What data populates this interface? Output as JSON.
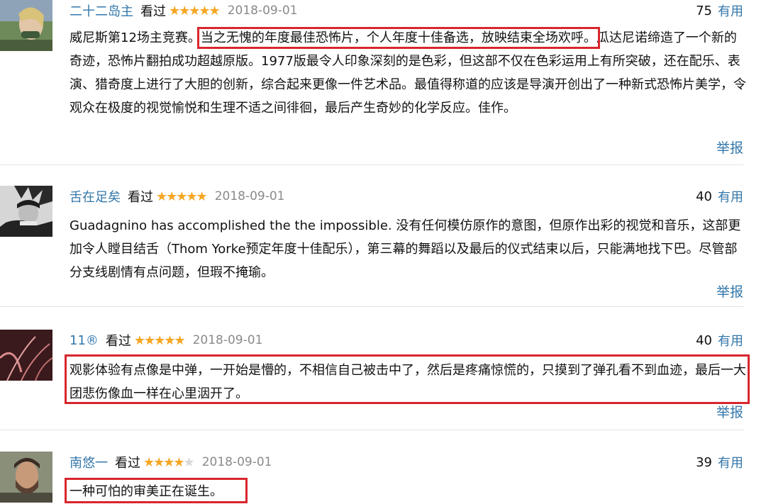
{
  "colors": {
    "link": "#3377aa",
    "star": "#f5a623",
    "highlight": "#d8262d",
    "date": "#8a8a8a"
  },
  "reviews": [
    {
      "author": "二十二岛主",
      "status": "看过",
      "rating_stars": 5,
      "date": "2018-09-01",
      "votes": "75",
      "useful_label": "有用",
      "text_before": "威尼斯第12场主竞赛。",
      "text_highlight": "当之无愧的年度最佳恐怖片，个人年度十佳备选，放映结束全场欢呼。",
      "text_after": "瓜达尼诺缔造了一个新的奇迹，恐怖片翻拍成功超越原版。1977版最令人印象深刻的是色彩，但这部不仅在色彩运用上有所突破，还在配乐、表演、猎奇度上进行了大胆的创新，综合起来更像一件艺术品。最值得称道的应该是导演开创出了一种新式恐怖片美学，令观众在极度的视觉愉悦和生理不适之间徘徊，最后产生奇妙的化学反应。佳作。",
      "report_label": "举报"
    },
    {
      "author": "舌在足矣",
      "status": "看过",
      "rating_stars": 5,
      "date": "2018-09-01",
      "votes": "40",
      "useful_label": "有用",
      "text": "Guadagnino has accomplished the the impossible. 没有任何模仿原作的意图，但原作出彩的视觉和音乐，这部更加令人瞠目结舌（Thom Yorke预定年度十佳配乐），第三幕的舞蹈以及最后的仪式结束以后，只能满地找下巴。尽管部分支线剧情有点问题，但瑕不掩瑜。",
      "report_label": "举报"
    },
    {
      "author": "11®",
      "status": "看过",
      "rating_stars": 5,
      "date": "2018-09-01",
      "votes": "40",
      "useful_label": "有用",
      "text": "观影体验有点像是中弹，一开始是懵的，不相信自己被击中了，然后是疼痛惊慌的，只摸到了弹孔看不到血迹，最后一大团悲伤像血一样在心里洇开了。",
      "report_label": "举报"
    },
    {
      "author": "南悠一",
      "status": "看过",
      "rating_stars": 4,
      "date": "2018-09-01",
      "votes": "39",
      "useful_label": "有用",
      "text": "一种可怕的审美正在诞生。"
    }
  ]
}
